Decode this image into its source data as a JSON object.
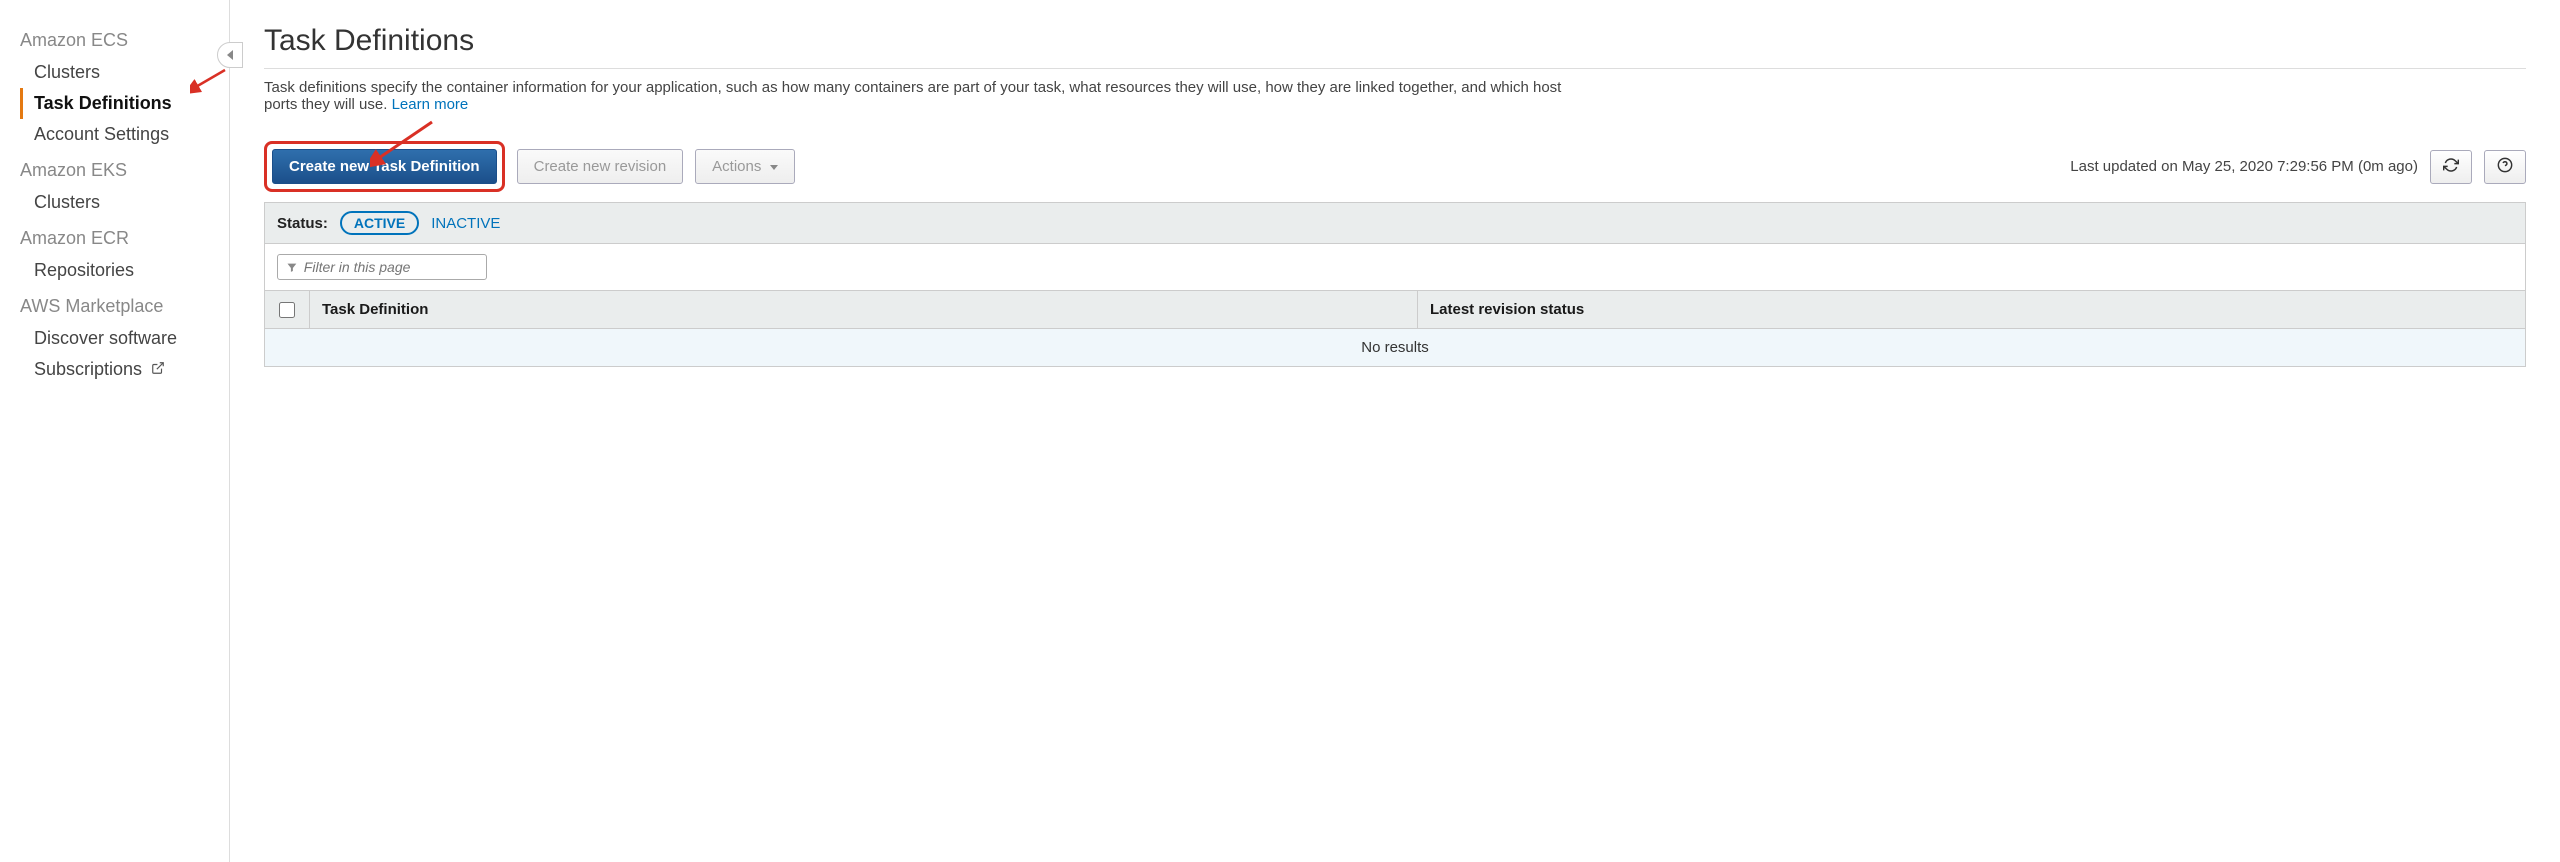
{
  "sidebar": {
    "groups": [
      {
        "label": "Amazon ECS",
        "items": [
          "Clusters",
          "Task Definitions",
          "Account Settings"
        ]
      },
      {
        "label": "Amazon EKS",
        "items": [
          "Clusters"
        ]
      },
      {
        "label": "Amazon ECR",
        "items": [
          "Repositories"
        ]
      },
      {
        "label": "AWS Marketplace",
        "items": [
          "Discover software",
          "Subscriptions"
        ]
      }
    ],
    "active_item": "Task Definitions"
  },
  "header": {
    "title": "Task Definitions",
    "description": "Task definitions specify the container information for your application, such as how many containers are part of your task, what resources they will use, how they are linked together, and which host ports they will use.",
    "learn_more": "Learn more"
  },
  "toolbar": {
    "create_new": "Create new Task Definition",
    "create_revision": "Create new revision",
    "actions": "Actions",
    "last_updated": "Last updated on May 25, 2020 7:29:56 PM (0m ago)"
  },
  "status": {
    "label": "Status:",
    "active": "ACTIVE",
    "inactive": "INACTIVE"
  },
  "filter": {
    "placeholder": "Filter in this page"
  },
  "table": {
    "col_task_definition": "Task Definition",
    "col_latest_revision_status": "Latest revision status",
    "no_results": "No results"
  }
}
